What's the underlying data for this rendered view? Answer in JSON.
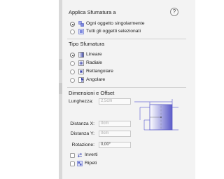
{
  "apply_section": {
    "title": "Applica Sfumatura a",
    "help_label": "?",
    "options": [
      {
        "label": "Ogni oggetto singolarmente",
        "selected": true,
        "icon": "single-object-icon"
      },
      {
        "label": "Tutti gli oggetti selezionati",
        "selected": false,
        "icon": "all-objects-icon"
      }
    ]
  },
  "type_section": {
    "title": "Tipo Sfumatura",
    "options": [
      {
        "label": "Lineare",
        "selected": true,
        "icon": "linear-gradient-icon"
      },
      {
        "label": "Radiale",
        "selected": false,
        "icon": "radial-gradient-icon"
      },
      {
        "label": "Rettangolare",
        "selected": false,
        "icon": "rectangular-gradient-icon"
      },
      {
        "label": "Angolare",
        "selected": false,
        "icon": "angular-gradient-icon"
      }
    ]
  },
  "dim_section": {
    "title": "Dimensioni e Offset",
    "length_label": "Lunghezza:",
    "length_value": "2,5cm",
    "distx_label": "Distanza X:",
    "distx_value": "0cm",
    "disty_label": "Distanza Y:",
    "disty_value": "0cm",
    "rotation_label": "Rotazione:",
    "rotation_value": "0,00°",
    "invert_label": "Inverti",
    "invert_checked": false,
    "repeat_label": "Ripeti",
    "repeat_checked": false
  },
  "colors": {
    "panel_bg": "#f3f3f3",
    "preview_gradient_start": "#ffffff",
    "preview_gradient_end": "#5a5ac8",
    "preview_lines": "#6b6bd6"
  }
}
